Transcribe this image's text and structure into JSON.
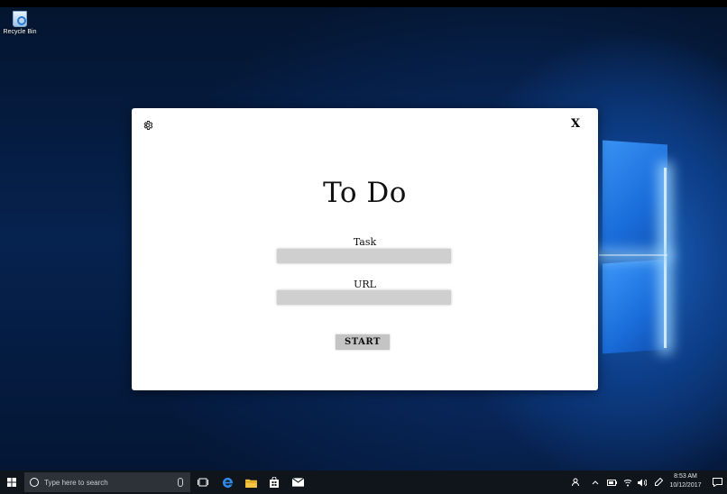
{
  "desktop": {
    "recycle_bin_label": "Recycle Bin"
  },
  "dialog": {
    "title": "To Do",
    "task_label": "Task",
    "url_label": "URL",
    "task_value": "",
    "url_value": "",
    "start_label": "START",
    "close_label": "X",
    "settings_icon": "gear-icon"
  },
  "taskbar": {
    "search_placeholder": "Type here to search",
    "time": "8:53 AM",
    "date": "10/12/2017",
    "pinned_icons": [
      "task-view-icon",
      "edge-icon",
      "file-explorer-icon",
      "store-icon",
      "mail-icon"
    ],
    "tray_icons": [
      "people-icon",
      "chevron-up-icon",
      "battery-icon",
      "network-icon",
      "volume-icon",
      "pen-icon"
    ]
  },
  "colors": {
    "taskbar": "#10151c",
    "accent": "#1a6fe0",
    "field": "#cfcfcf",
    "button": "#c4c4c4"
  }
}
